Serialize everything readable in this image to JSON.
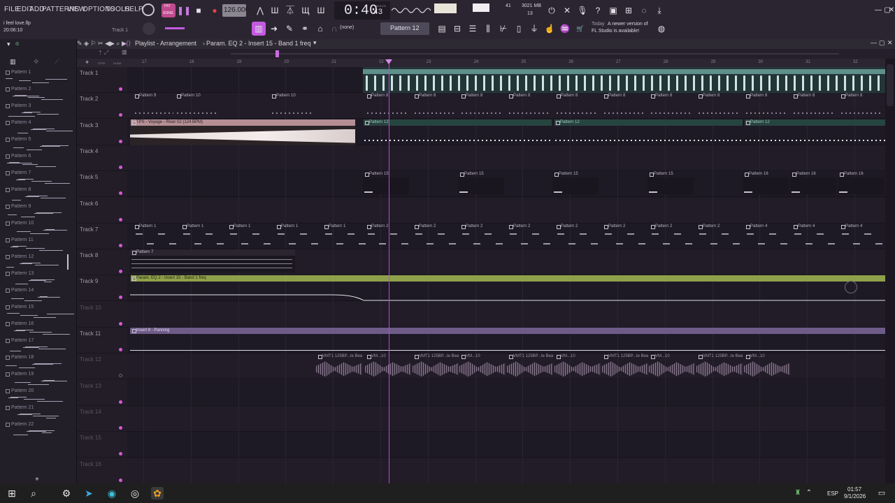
{
  "menu": {
    "items": [
      "FILE",
      "EDIT",
      "ADD",
      "PATTERNS",
      "VIEW",
      "OPTIONS",
      "TOOLS",
      "HELP"
    ],
    "file_name": "i feel love.flp",
    "elapsed": "20:06:10",
    "track_hint": "Track 1"
  },
  "transport": {
    "tempo": "126.000",
    "time_main": "0:40",
    "time_frac": "43",
    "time_label": "M:S:CS",
    "cpu": "41",
    "memory": "3021 MB",
    "voices": "13",
    "mode_label": "PAT",
    "song_label": "SONG"
  },
  "toolbar": {
    "snap_value": "(none)",
    "pattern_selector": "Pattern 12",
    "news_date": "Today",
    "news_text_1": "A newer version of",
    "news_text_2": "FL Studio is available!"
  },
  "playlist": {
    "title": "Playlist - Arrangement",
    "breadcrumb": "Param. EQ 2 - Insert 15 - Band 1 freq",
    "tool_step": "STEP",
    "tool_slide": "SLIDE"
  },
  "browser": {
    "patterns": [
      "Pattern 1",
      "Pattern 2",
      "Pattern 3",
      "Pattern 4",
      "Pattern 5",
      "Pattern 6",
      "Pattern 7",
      "Pattern 8",
      "Pattern 9",
      "Pattern 10",
      "Pattern 11",
      "Pattern 12",
      "Pattern 13",
      "Pattern 14",
      "Pattern 15",
      "Pattern 16",
      "Pattern 17",
      "Pattern 18",
      "Pattern 19",
      "Pattern 20",
      "Pattern 21",
      "Pattern 22"
    ],
    "selected": "Pattern 12"
  },
  "ruler": {
    "bars": [
      "17",
      "18",
      "19",
      "20",
      "21",
      "22",
      "23",
      "24",
      "25",
      "26",
      "27",
      "28",
      "29",
      "30",
      "31",
      "32"
    ]
  },
  "tracks": [
    {
      "name": "Track 1",
      "active": true
    },
    {
      "name": "Track 2",
      "active": true
    },
    {
      "name": "Track 3",
      "active": true
    },
    {
      "name": "Track 4",
      "active": true
    },
    {
      "name": "Track 5",
      "active": true
    },
    {
      "name": "Track 6",
      "active": true
    },
    {
      "name": "Track 7",
      "active": true
    },
    {
      "name": "Track 8",
      "active": true
    },
    {
      "name": "Track 9",
      "active": true
    },
    {
      "name": "Track 10",
      "active": true
    },
    {
      "name": "Track 11",
      "active": true
    },
    {
      "name": "Track 12",
      "active": false
    },
    {
      "name": "Track 13",
      "active": true
    },
    {
      "name": "Track 14",
      "active": true
    },
    {
      "name": "Track 15",
      "active": true
    },
    {
      "name": "Track 16",
      "active": true
    }
  ],
  "clips": {
    "t2": [
      "Pattern 9",
      "Pattern 10",
      "Pattern 10",
      "Pattern 8",
      "Pattern 8",
      "Pattern 8",
      "Pattern 8",
      "Pattern 8",
      "Pattern 8",
      "Pattern 8",
      "Pattern 8",
      "Pattern 8",
      "Pattern 8",
      "Pattern 8"
    ],
    "t3_audio": "TPS - Voyage - Riser 02 (124 BPM)",
    "t3": [
      "Pattern 12",
      "Pattern 12",
      "Pattern 12"
    ],
    "t5": [
      "Pattern 15",
      "Pattern 15",
      "Pattern 15",
      "Pattern 15",
      "Pattern 16",
      "Pattern 16",
      "Pattern 16"
    ],
    "t7": [
      "Pattern 1",
      "Pattern 1",
      "Pattern 1",
      "Pattern 1",
      "Pattern 1",
      "Pattern 2",
      "Pattern 2",
      "Pattern 2",
      "Pattern 2",
      "Pattern 2",
      "Pattern 2",
      "Pattern 2",
      "Pattern 2",
      "Pattern 4",
      "Pattern 4",
      "Pattern 4"
    ],
    "t8": "Pattern 7",
    "t9_auto": "Param. EQ 2 - Insert 15 - Band 1 freq",
    "t11_auto": "Insert 9 - Panning",
    "t12_audio": [
      "VMT1 125BP...te Beats 10",
      "VM...10",
      "VMT1 125BP...te Beats 10",
      "VM...10",
      "VMT1 125BP...te Beats 10",
      "VM...10",
      "VMT1 125BP...te Beats 10",
      "VM...10",
      "VMT1 125BP...te Beats 10",
      "VM...10"
    ]
  },
  "taskbar": {
    "language": "ESP",
    "time": "01:57",
    "date": "9/1/2026"
  },
  "colors": {
    "accent": "#b94ad8",
    "clip_teal": "#5f8f8a",
    "clip_green": "#8fa04a",
    "clip_purple": "#6e5c88",
    "clip_pink": "#b58f94"
  }
}
